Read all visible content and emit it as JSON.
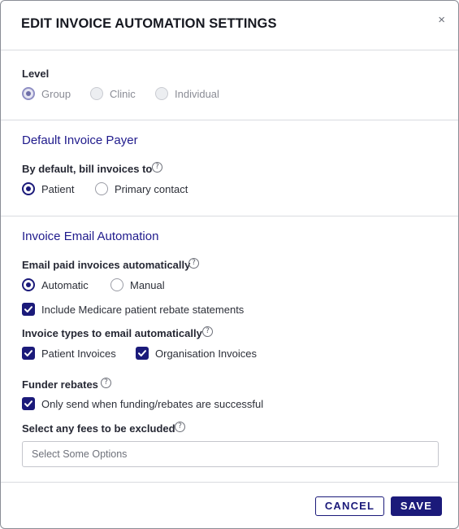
{
  "dialog": {
    "title": "EDIT INVOICE AUTOMATION SETTINGS",
    "close_label": "×"
  },
  "level": {
    "label": "Level",
    "options": [
      {
        "label": "Group",
        "selected": true,
        "disabled": true
      },
      {
        "label": "Clinic",
        "selected": false,
        "disabled": true
      },
      {
        "label": "Individual",
        "selected": false,
        "disabled": true
      }
    ]
  },
  "default_payer": {
    "title": "Default Invoice Payer",
    "bill_label": "By default, bill invoices to",
    "options": [
      {
        "label": "Patient",
        "selected": true
      },
      {
        "label": "Primary contact",
        "selected": false
      }
    ]
  },
  "email_automation": {
    "title": "Invoice Email Automation",
    "paid_label": "Email paid invoices automatically",
    "paid_options": [
      {
        "label": "Automatic",
        "selected": true
      },
      {
        "label": "Manual",
        "selected": false
      }
    ],
    "medicare_label": "Include Medicare patient rebate statements",
    "medicare_checked": true,
    "types_label": "Invoice types to email automatically",
    "types": [
      {
        "label": "Patient Invoices",
        "checked": true
      },
      {
        "label": "Organisation Invoices",
        "checked": true
      }
    ],
    "funder_label": "Funder rebates",
    "funder_option": "Only send when funding/rebates are successful",
    "funder_checked": true,
    "fees_label": "Select any fees to be excluded",
    "fees_placeholder": "Select Some Options"
  },
  "help_glyph": "?",
  "footer": {
    "cancel_label": "CANCEL",
    "save_label": "SAVE"
  },
  "colors": {
    "accent": "#1b1a7a",
    "section_title": "#1f1a8c",
    "divider": "#d9dbe0"
  }
}
